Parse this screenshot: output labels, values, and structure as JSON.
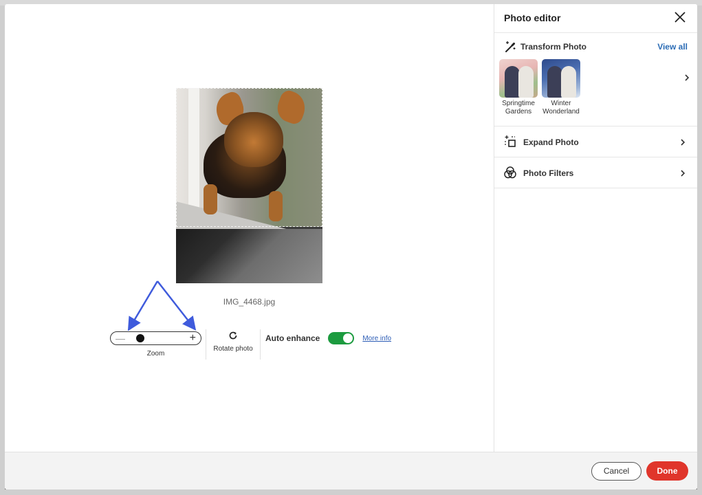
{
  "panel": {
    "title": "Photo editor",
    "transform": {
      "title": "Transform Photo",
      "view_all": "View all",
      "options": [
        {
          "label_line1": "Springtime",
          "label_line2": "Gardens"
        },
        {
          "label_line1": "Winter",
          "label_line2": "Wonderland"
        }
      ]
    },
    "expand": {
      "title": "Expand Photo"
    },
    "filters": {
      "title": "Photo Filters"
    }
  },
  "canvas": {
    "filename": "IMG_4468.jpg",
    "zoom_label": "Zoom",
    "zoom_level": 0.2,
    "rotate_label": "Rotate photo",
    "auto_enhance_label": "Auto enhance",
    "auto_enhance_on": true,
    "more_info": "More info"
  },
  "footer": {
    "cancel": "Cancel",
    "done": "Done"
  },
  "colors": {
    "done_button": "#e0352b",
    "toggle_on": "#1c9b3f",
    "link": "#2a6bb5",
    "annotation_arrow": "#3f5bdc"
  },
  "icons": [
    "close-icon",
    "wand-icon",
    "expand-icon",
    "filters-icon",
    "chevron-right-icon",
    "rotate-icon"
  ]
}
